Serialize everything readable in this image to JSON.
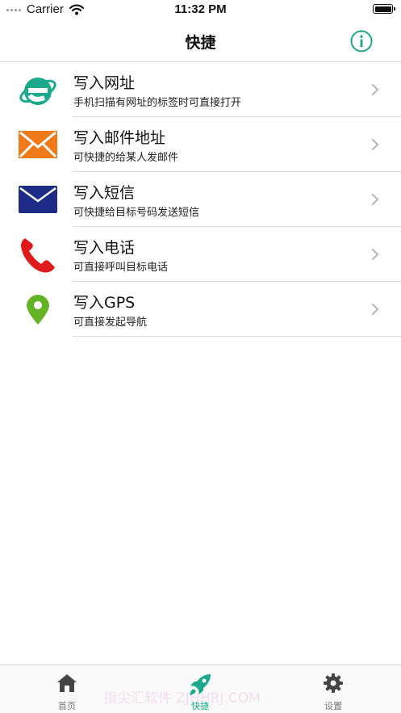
{
  "status_bar": {
    "carrier": "Carrier",
    "time": "11:32 PM"
  },
  "nav": {
    "title": "快捷",
    "info_icon": "info-circle-icon",
    "accent": "#1aa98a"
  },
  "items": [
    {
      "title": "写入网址",
      "subtitle": "手机扫描有网址的标签时可直接打开",
      "icon": "browser-e-icon",
      "color": "#1aa98a"
    },
    {
      "title": "写入邮件地址",
      "subtitle": "可快捷的给某人发邮件",
      "icon": "envelope-orange-icon",
      "color": "#f07a1a"
    },
    {
      "title": "写入短信",
      "subtitle": "可快捷给目标号码发送短信",
      "icon": "envelope-blue-icon",
      "color": "#1c2b86"
    },
    {
      "title": "写入电话",
      "subtitle": "可直接呼叫目标电话",
      "icon": "phone-icon",
      "color": "#e01a1a"
    },
    {
      "title": "写入GPS",
      "subtitle": "可直接发起导航",
      "icon": "map-pin-icon",
      "color": "#63b324"
    }
  ],
  "tabs": [
    {
      "label": "首页",
      "icon": "home-icon",
      "active": false
    },
    {
      "label": "快捷",
      "icon": "rocket-icon",
      "active": true
    },
    {
      "label": "设置",
      "icon": "gear-icon",
      "active": false
    }
  ],
  "watermark": "指尖汇软件 ZJHHRJ.COM"
}
